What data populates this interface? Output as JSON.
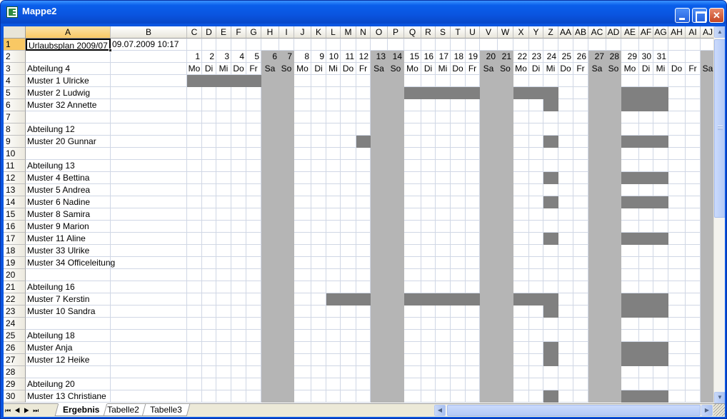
{
  "window": {
    "title": "Mappe2"
  },
  "columns": [
    "A",
    "B",
    "C",
    "D",
    "E",
    "F",
    "G",
    "H",
    "I",
    "J",
    "K",
    "L",
    "M",
    "N",
    "O",
    "P",
    "Q",
    "R",
    "S",
    "T",
    "U",
    "V",
    "W",
    "X",
    "Y",
    "Z",
    "AA",
    "AB",
    "AC",
    "AD",
    "AE",
    "AF",
    "AG",
    "AH",
    "AI",
    "AJ"
  ],
  "rows": [
    "1",
    "2",
    "3",
    "4",
    "5",
    "6",
    "7",
    "8",
    "9",
    "10",
    "11",
    "12",
    "13",
    "14",
    "15",
    "16",
    "17",
    "18",
    "19",
    "20",
    "21",
    "22",
    "23",
    "24",
    "25",
    "26",
    "27",
    "28",
    "29",
    "30"
  ],
  "cells": {
    "A1": "Urlaubsplan 2009/07",
    "B1": "09.07.2009 10:17",
    "A3": "Abteilung 4",
    "A4": "Muster 1 Ulricke",
    "A5": "Muster 2 Ludwig",
    "A6": "Muster 32 Annette",
    "A8": "Abteilung 12",
    "A9": "Muster 20 Gunnar",
    "A11": "Abteilung 13",
    "A12": "Muster 4 Bettina",
    "A13": "Muster 5 Andrea",
    "A14": "Muster 6 Nadine",
    "A15": "Muster 8 Samira",
    "A16": "Muster 9 Marion",
    "A17": "Muster 11 Aline",
    "A18": "Muster 33 Ulrike",
    "A19": "Muster 34 Officeleitung",
    "A21": "Abteilung 16",
    "A22": "Muster 7 Kerstin",
    "A23": "Muster 10 Sandra",
    "A25": "Abteilung 18",
    "A26": "Muster Anja",
    "A27": "Muster 12 Heike",
    "A29": "Abteilung 20",
    "A30": "Muster 13 Christiane"
  },
  "days": [
    "1",
    "2",
    "3",
    "4",
    "5",
    "6",
    "7",
    "8",
    "9",
    "10",
    "11",
    "12",
    "13",
    "14",
    "15",
    "16",
    "17",
    "18",
    "19",
    "20",
    "21",
    "22",
    "23",
    "24",
    "25",
    "26",
    "27",
    "28",
    "29",
    "30",
    "31"
  ],
  "weekdays": [
    "Mo",
    "Di",
    "Mi",
    "Do",
    "Fr",
    "Sa",
    "So",
    "Mo",
    "Di",
    "Mi",
    "Do",
    "Fr",
    "Sa",
    "So",
    "Mo",
    "Di",
    "Mi",
    "Do",
    "Fr",
    "Sa",
    "So",
    "Mo",
    "Di",
    "Mi",
    "Do",
    "Fr",
    "Sa",
    "So",
    "Mo",
    "Di",
    "Mi",
    "Do",
    "Fr",
    "Sa"
  ],
  "vacation_cells": {
    "4": [
      "C",
      "D",
      "E",
      "F",
      "G"
    ],
    "5": [
      "Q",
      "R",
      "S",
      "T",
      "U",
      "X",
      "Y",
      "Z",
      "AE",
      "AF",
      "AG"
    ],
    "6": [
      "Z",
      "AE",
      "AF",
      "AG"
    ],
    "9": [
      "N",
      "Z",
      "AE",
      "AF",
      "AG"
    ],
    "12": [
      "Z",
      "AE",
      "AF",
      "AG"
    ],
    "14": [
      "Z",
      "AE",
      "AF",
      "AG"
    ],
    "17": [
      "Z",
      "AE",
      "AF",
      "AG"
    ],
    "22": [
      "L",
      "M",
      "N",
      "Q",
      "R",
      "S",
      "T",
      "U",
      "X",
      "Y",
      "Z",
      "AE",
      "AF",
      "AG"
    ],
    "23": [
      "Z",
      "AE",
      "AF",
      "AG"
    ],
    "26": [
      "Z",
      "AE",
      "AF",
      "AG"
    ],
    "27": [
      "Z",
      "AE",
      "AF",
      "AG"
    ],
    "30": [
      "Z",
      "AE",
      "AF",
      "AG"
    ]
  },
  "weekend_columns": [
    "H",
    "I",
    "O",
    "P",
    "V",
    "W",
    "AC",
    "AD",
    "AJ"
  ],
  "active_cell": "A1",
  "sheet_tabs": [
    {
      "label": "Ergebnis",
      "active": true
    },
    {
      "label": "Tabelle2",
      "active": false
    },
    {
      "label": "Tabelle3",
      "active": false
    }
  ],
  "colors": {
    "vacation": "#808080",
    "weekend": "#B5B5B5",
    "selection": "#F9C864",
    "titlebar": "#0A55E0"
  }
}
